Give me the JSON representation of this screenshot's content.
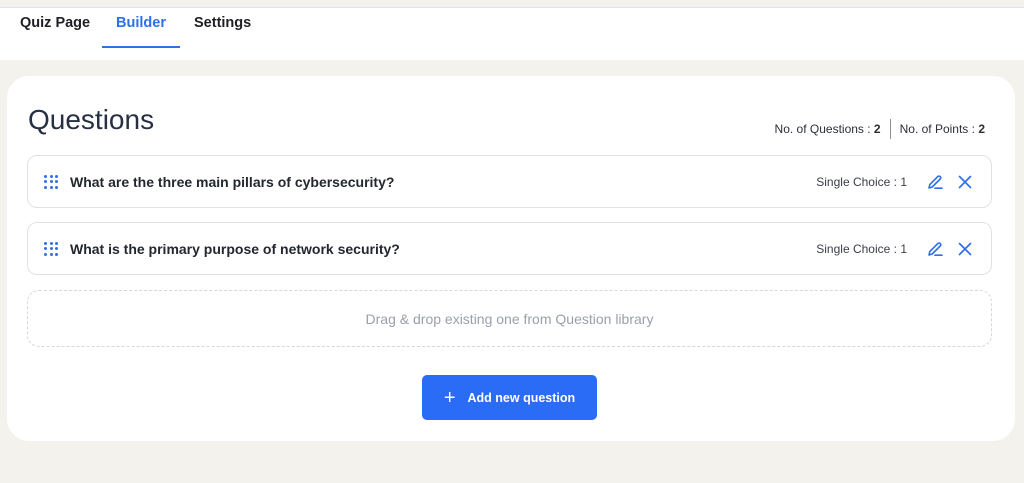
{
  "tabs": [
    {
      "label": "Quiz Page"
    },
    {
      "label": "Builder"
    },
    {
      "label": "Settings"
    }
  ],
  "active_tab": "Builder",
  "section": {
    "title": "Questions",
    "questions_label": "No. of Questions : ",
    "questions_count": "2",
    "points_label": "No. of Points : ",
    "points_count": "2"
  },
  "questions": [
    {
      "text": "What are the three main pillars of cybersecurity?",
      "type": "Single Choice : 1"
    },
    {
      "text": "What is the primary purpose of network security?",
      "type": "Single Choice : 1"
    }
  ],
  "dropzone_text": "Drag & drop existing one from Question library",
  "add_button": {
    "icon": "+",
    "label": "Add new question"
  },
  "colors": {
    "accent": "#2f6fe8",
    "button": "#2b6cf6",
    "background": "#f4f2ec"
  },
  "icons": [
    "drag-handle-icon",
    "pencil-icon",
    "close-icon",
    "plus-icon"
  ]
}
